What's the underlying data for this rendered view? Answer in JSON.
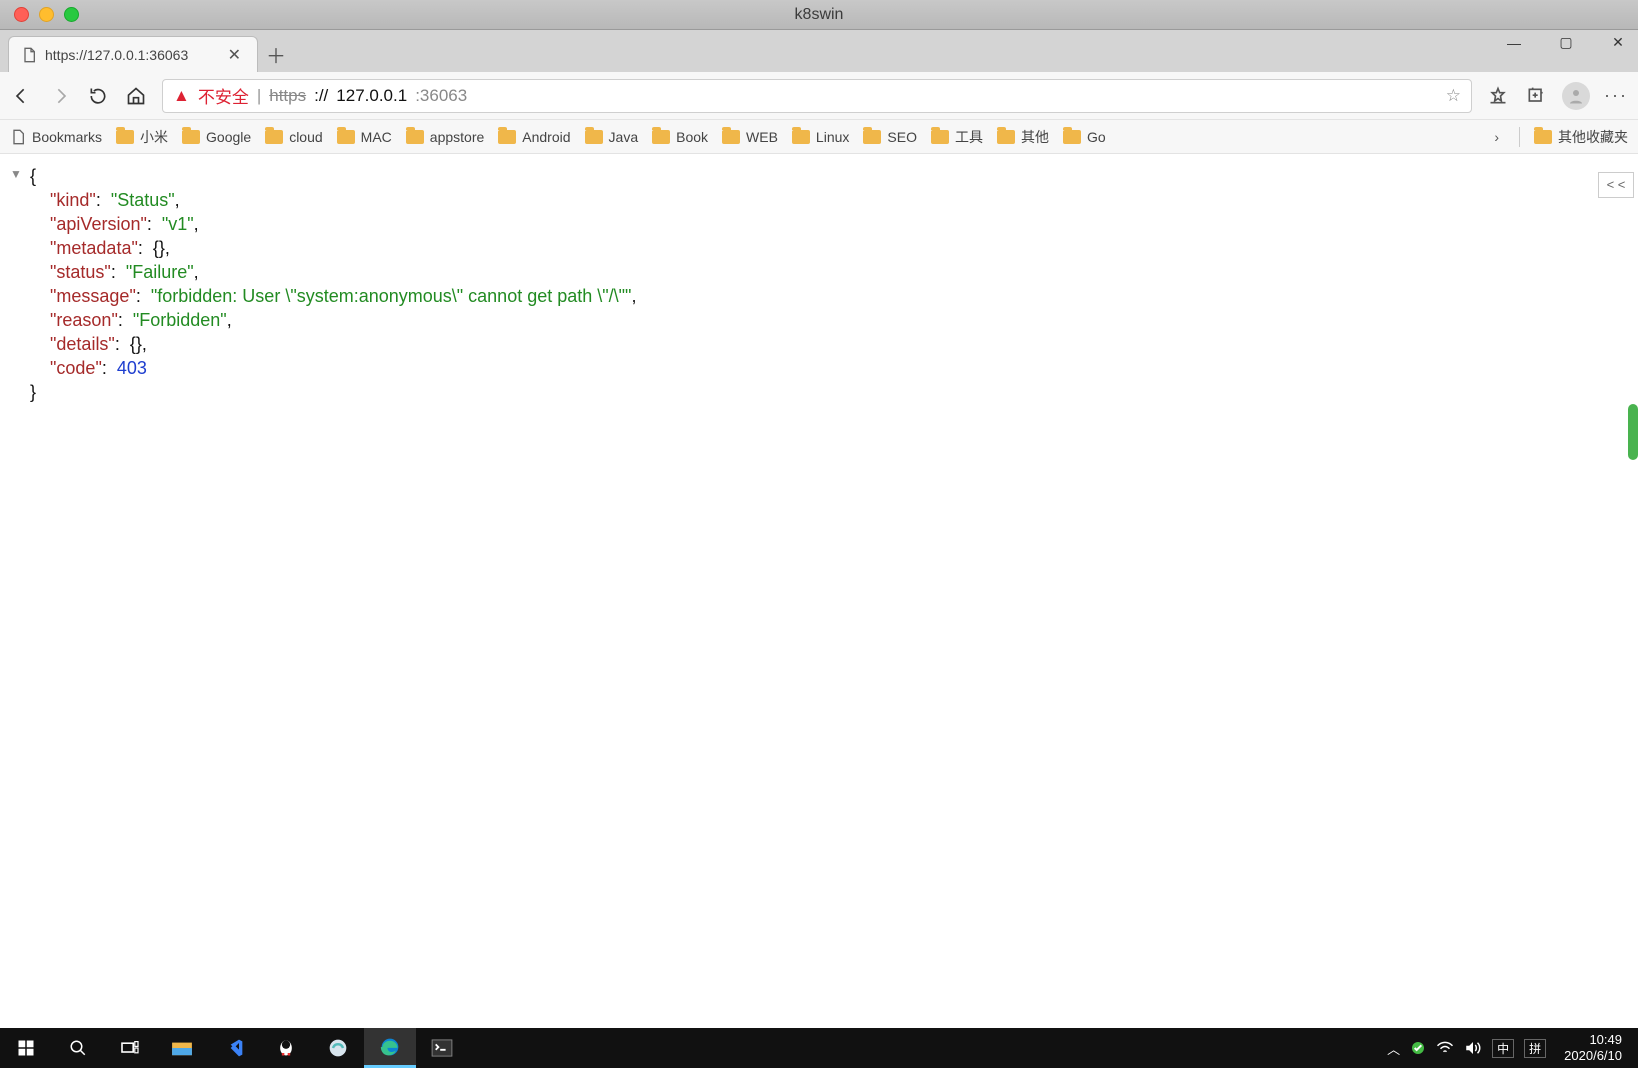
{
  "window_title": "k8swin",
  "tab": {
    "title": "https://127.0.0.1:36063"
  },
  "address": {
    "security_text": "不安全",
    "scheme": "https",
    "sep": "://",
    "host": "127.0.0.1",
    "port": ":36063"
  },
  "bookmarks": {
    "first": "Bookmarks",
    "items": [
      "小米",
      "Google",
      "cloud",
      "MAC",
      "appstore",
      "Android",
      "Java",
      "Book",
      "WEB",
      "Linux",
      "SEO",
      "工具",
      "其他",
      "Go"
    ],
    "overflow": "其他收藏夹"
  },
  "json": {
    "kind_key": "\"kind\"",
    "kind_val": "\"Status\"",
    "apiv_key": "\"apiVersion\"",
    "apiv_val": "\"v1\"",
    "meta_key": "\"metadata\"",
    "status_key": "\"status\"",
    "status_val": "\"Failure\"",
    "msg_key": "\"message\"",
    "msg_val": "\"forbidden: User \\\"system:anonymous\\\" cannot get path \\\"/\\\"\"",
    "reason_key": "\"reason\"",
    "reason_val": "\"Forbidden\"",
    "details_key": "\"details\"",
    "code_key": "\"code\"",
    "code_val": "403"
  },
  "collapse_label": "< <",
  "tray": {
    "time": "10:49",
    "date": "2020/6/10",
    "ime1": "中",
    "ime2": "拼"
  }
}
